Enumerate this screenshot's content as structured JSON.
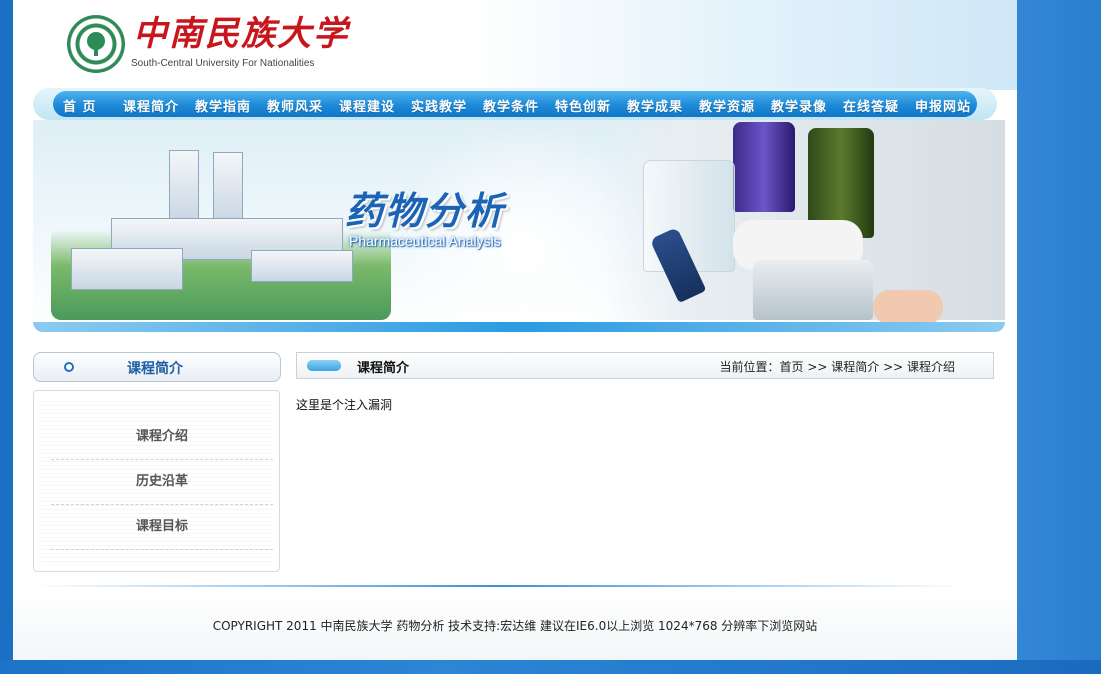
{
  "header": {
    "logo_cn": "中南民族大学",
    "logo_en": "South-Central University For Nationalities"
  },
  "nav": {
    "items": [
      "首 页",
      "课程简介",
      "教学指南",
      "教师风采",
      "课程建设",
      "实践教学",
      "教学条件",
      "特色创新",
      "教学成果",
      "教学资源",
      "教学录像",
      "在线答疑",
      "申报网站"
    ]
  },
  "banner": {
    "title_cn": "药物分析",
    "title_en": "Pharmaceutical Analysis"
  },
  "sidebar": {
    "heading": "课程简介",
    "items": [
      "课程介绍",
      "历史沿革",
      "课程目标"
    ]
  },
  "main": {
    "section_title": "课程简介",
    "breadcrumb": "当前位置：首页 >> 课程简介 >> 课程介绍",
    "content": "这里是个注入漏洞"
  },
  "footer": {
    "copyright": "COPYRIGHT 2011 中南民族大学 药物分析 技术支持:宏达维 建议在IE6.0以上浏览 1024*768 分辨率下浏览网站"
  },
  "colors": {
    "nav_blue": "#1d8ad8",
    "heading_blue": "#1f5fa8",
    "logo_red": "#c8161d"
  }
}
